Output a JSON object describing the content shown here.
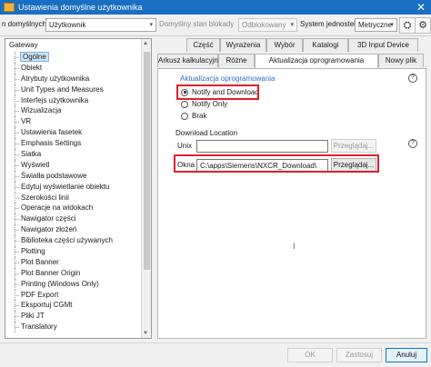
{
  "window": {
    "title": "Ustawienia domyślne użytkownika",
    "close_glyph": "✕"
  },
  "toolbar": {
    "defaults_label": "n domyślnych",
    "level_value": "Użytkownik",
    "lock_state_label": "Domyślny stan blokady",
    "lock_state_value": "Odblokowany",
    "unit_system_label": "System jednostek",
    "unit_system_value": "Metryczne",
    "chevron": "▾",
    "binoculars_glyph": "⛭",
    "settings_glyph": "⚙"
  },
  "tree": {
    "root": "Gateway",
    "items": [
      "Ogólne",
      "Obiekt",
      "Atrybuty użytkownika",
      "Unit Types and Measures",
      "Interfejs użytkownika",
      "Wizualizacja",
      "VR",
      "Ustawienia fasetek",
      "Emphasis Settings",
      "Siatka",
      "Wyświetl",
      "Światła podstawowe",
      "Edytuj wyświetlanie obiektu",
      "Szerokości linii",
      "Operacje na widokach",
      "Nawigator części",
      "Nawigator złożeń",
      "Biblioteka części używanych",
      "Plotting",
      "Plot Banner",
      "Plot Banner Origin",
      "Printing (Windows Only)",
      "PDF Export",
      "Eksportuj CGMt",
      "Pliki JT",
      "Translatory"
    ],
    "selected_index": 0
  },
  "tabs": {
    "row1": [
      "Część",
      "Wyrażenia",
      "Wybór",
      "Katalogi",
      "3D Input Device"
    ],
    "row2": [
      "Arkusz kalkulacyjny",
      "Różne",
      "Aktualizacja oprogramowania",
      "Nowy plik"
    ],
    "active": "Aktualizacja oprogramowania"
  },
  "update_group": {
    "title": "Aktualizacja oprogramowania",
    "options": [
      "Notify and Download",
      "Notify Only",
      "Brak"
    ],
    "selected": "Notify and Download",
    "help_glyph": "?"
  },
  "download": {
    "title": "Download Location",
    "unix_label": "Unix",
    "unix_value": "",
    "unix_browse": "Przeglądaj...",
    "windows_label": "Okna",
    "windows_value": "C:\\apps\\Siemens\\NXCR_Download\\",
    "windows_browse": "Przeglądaj...",
    "help_glyph": "?"
  },
  "footer": {
    "ok": "OK",
    "apply": "Zastosuj",
    "cancel": "Anuluj"
  },
  "colors": {
    "title_bar": "#1b6ec2",
    "highlight_box": "#e0202c",
    "group_title": "#2f6fbf",
    "selection": "#cde4f7"
  }
}
